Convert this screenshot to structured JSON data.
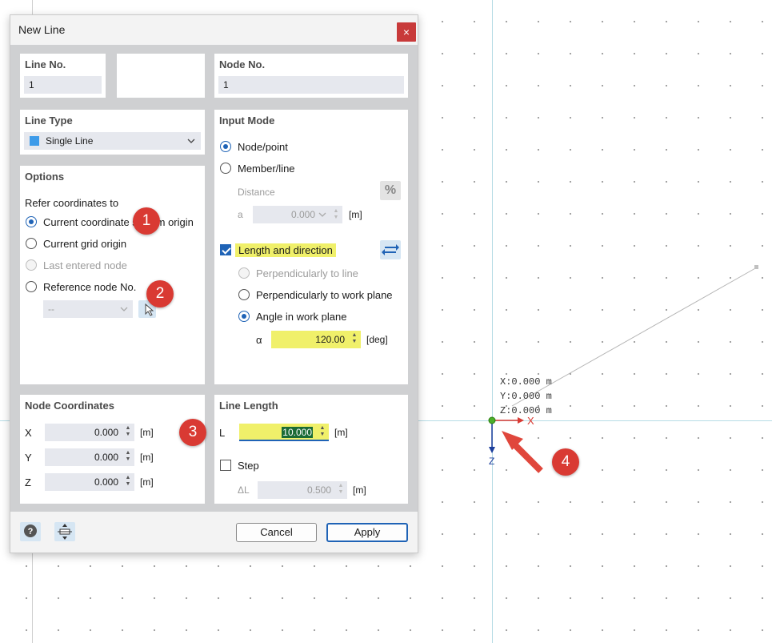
{
  "dialog": {
    "title": "New Line",
    "close_icon": "×",
    "line_no": {
      "label": "Line No.",
      "value": "1"
    },
    "node_no": {
      "label": "Node No.",
      "value": "1"
    },
    "line_type": {
      "label": "Line Type",
      "value": "Single Line",
      "color": "#3d9be9"
    },
    "options": {
      "label": "Options",
      "refer_label": "Refer coordinates to",
      "radios": [
        "Current coordinate system origin",
        "Current grid origin",
        "Last entered node",
        "Reference node No."
      ],
      "reference_value": "--"
    },
    "input_mode": {
      "label": "Input Mode",
      "node_point": "Node/point",
      "member_line": "Member/line",
      "distance_label": "Distance",
      "percent_icon": "%",
      "a_label": "a",
      "a_value": "0.000",
      "a_unit": "[m]",
      "length_direction": "Length and direction",
      "perp_line": "Perpendicularly to line",
      "perp_plane": "Perpendicularly to work plane",
      "angle_plane": "Angle in work plane",
      "alpha_label": "α",
      "alpha_value": "120.00",
      "alpha_unit": "[deg]"
    },
    "node_coords": {
      "label": "Node Coordinates",
      "x_label": "X",
      "x_value": "0.000",
      "y_label": "Y",
      "y_value": "0.000",
      "z_label": "Z",
      "z_value": "0.000",
      "unit": "[m]"
    },
    "line_length": {
      "label": "Line Length",
      "l_label": "L",
      "l_value": "10.000",
      "l_unit": "[m]",
      "step_label": "Step",
      "delta_label": "ΔL",
      "delta_value": "0.500",
      "delta_unit": "[m]"
    },
    "buttons": {
      "cancel": "Cancel",
      "apply": "Apply"
    }
  },
  "canvas": {
    "coords": [
      "X:0.000 m",
      "Y:0.000 m",
      "Z:0.000 m"
    ],
    "x_axis": "X",
    "z_axis": "Z"
  },
  "annotations": [
    "1",
    "2",
    "3",
    "4"
  ],
  "colors": {
    "accent": "#1f63b6",
    "highlight": "#f0f06a",
    "arrow": "#e0473c",
    "close": "#c83a3a"
  }
}
